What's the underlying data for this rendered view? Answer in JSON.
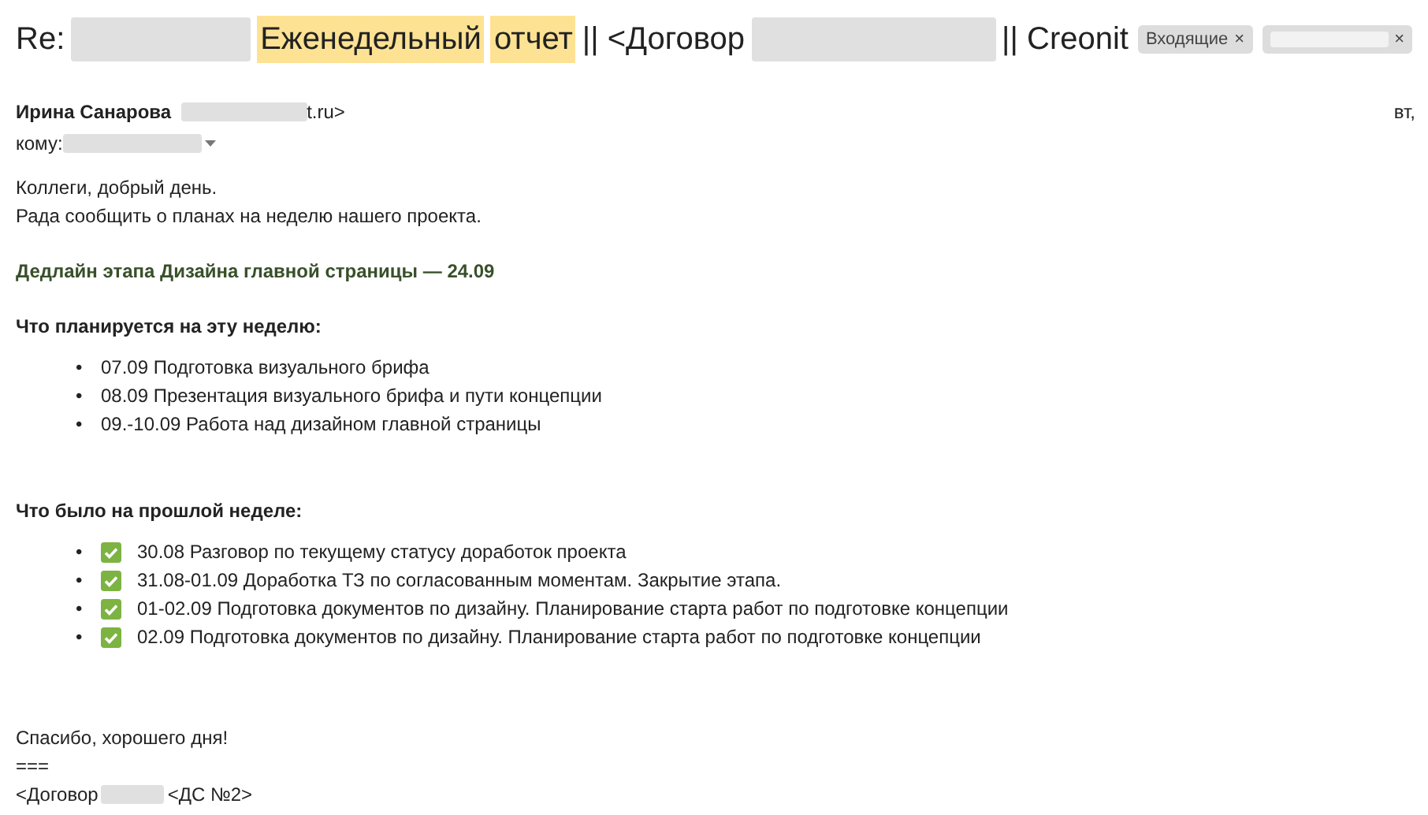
{
  "subject": {
    "parts": [
      {
        "kind": "text",
        "text": "Re:"
      },
      {
        "kind": "redacted"
      },
      {
        "kind": "highlight",
        "text": "Еженедельный"
      },
      {
        "kind": "highlight",
        "text": "отчет"
      },
      {
        "kind": "text",
        "text": "|| <Договор"
      },
      {
        "kind": "redacted"
      },
      {
        "kind": "text",
        "text": "|| Creonit"
      }
    ],
    "labels": [
      {
        "redacted": false,
        "text": "Входящие",
        "close": "×"
      },
      {
        "redacted": true,
        "close": "×"
      }
    ]
  },
  "sender": {
    "name": "Ирина Санарова",
    "email_tail": "t.ru>",
    "date": "вт,"
  },
  "recipient": {
    "label": "кому:"
  },
  "body": {
    "greeting": [
      "Коллеги, добрый день.",
      "Рада сообщить о планах на неделю нашего проекта."
    ],
    "deadline": "Дедлайн этапа Дизайна главной страницы — 24.09",
    "marker": "•",
    "sections": [
      {
        "heading": "Что планируется на эту неделю:",
        "items": [
          {
            "done": false,
            "text": "07.09 Подготовка визуального брифа"
          },
          {
            "done": false,
            "text": "08.09 Презентация визуального брифа и пути концепции"
          },
          {
            "done": false,
            "text": "09.-10.09 Работа над дизайном главной страницы"
          }
        ]
      },
      {
        "heading": "Что было на прошлой неделе:",
        "items": [
          {
            "done": true,
            "text": "30.08 Разговор по текущему статусу доработок проекта"
          },
          {
            "done": true,
            "text": "31.08-01.09 Доработка ТЗ по согласованным моментам. Закрытие этапа."
          },
          {
            "done": true,
            "text": "01-02.09 Подготовка документов по дизайну. Планирование старта работ по подготовке концепции"
          },
          {
            "done": true,
            "text": "02.09 Подготовка документов по дизайну. Планирование старта работ по подготовке концепции"
          }
        ]
      }
    ],
    "closing": "Спасибо, хорошего дня!",
    "separator": "===",
    "footer": [
      {
        "kind": "text",
        "text": "<Договор"
      },
      {
        "kind": "redacted"
      },
      {
        "kind": "text",
        "text": "<ДС №2>"
      }
    ]
  }
}
